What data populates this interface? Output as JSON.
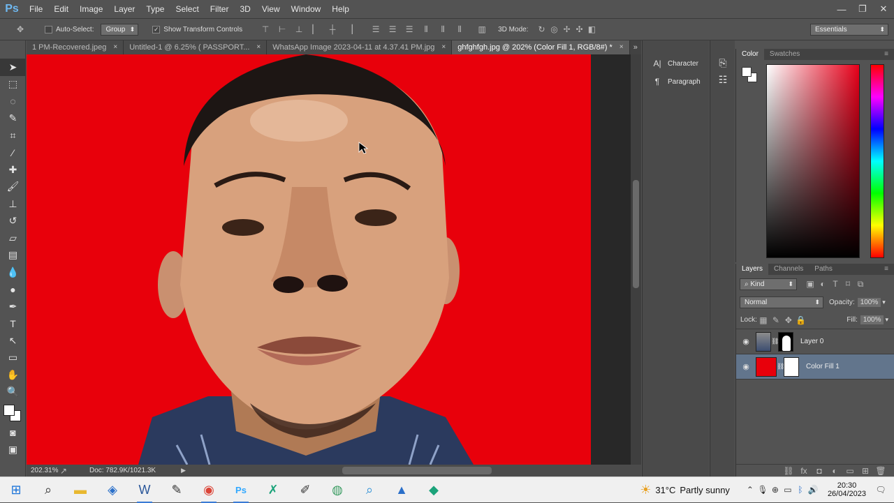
{
  "app": {
    "logo": "Ps"
  },
  "menu": [
    "File",
    "Edit",
    "Image",
    "Layer",
    "Type",
    "Select",
    "Filter",
    "3D",
    "View",
    "Window",
    "Help"
  ],
  "window_controls": {
    "minimize": "—",
    "restore": "❐",
    "close": "✕"
  },
  "options": {
    "auto_select_label": "Auto-Select:",
    "auto_select_value": "Group",
    "show_transform_label": "Show Transform Controls",
    "mode_3d_label": "3D Mode:",
    "workspace": "Essentials"
  },
  "tabs": [
    {
      "label": "1 PM-Recovered.jpeg",
      "close": "×"
    },
    {
      "label": "Untitled-1 @ 6.25% ( PASSPORT...",
      "close": "×"
    },
    {
      "label": "WhatsApp Image 2023-04-11 at 4.37.41 PM.jpg",
      "close": "×"
    },
    {
      "label": "ghfghfgh.jpg @ 202% (Color Fill 1, RGB/8#) *",
      "close": "×"
    }
  ],
  "status": {
    "zoom": "202.31%",
    "doc": "Doc: 782.9K/1021.3K"
  },
  "side_panel": {
    "character": "Character",
    "paragraph": "Paragraph"
  },
  "color_panel": {
    "tabs": [
      "Color",
      "Swatches"
    ]
  },
  "layers_panel": {
    "tabs": [
      "Layers",
      "Channels",
      "Paths"
    ],
    "filter_kind": "Kind",
    "blend_mode": "Normal",
    "opacity_label": "Opacity:",
    "opacity_value": "100%",
    "lock_label": "Lock:",
    "fill_label": "Fill:",
    "fill_value": "100%",
    "layers": [
      {
        "name": "Layer 0",
        "selected": false
      },
      {
        "name": "Color Fill 1",
        "selected": true
      }
    ]
  },
  "taskbar": {
    "weather_temp": "31°C",
    "weather_desc": "Partly sunny",
    "time": "20:30",
    "date": "26/04/2023"
  },
  "colors": {
    "canvas_bg": "#e8000b",
    "accent": "#62758c"
  }
}
